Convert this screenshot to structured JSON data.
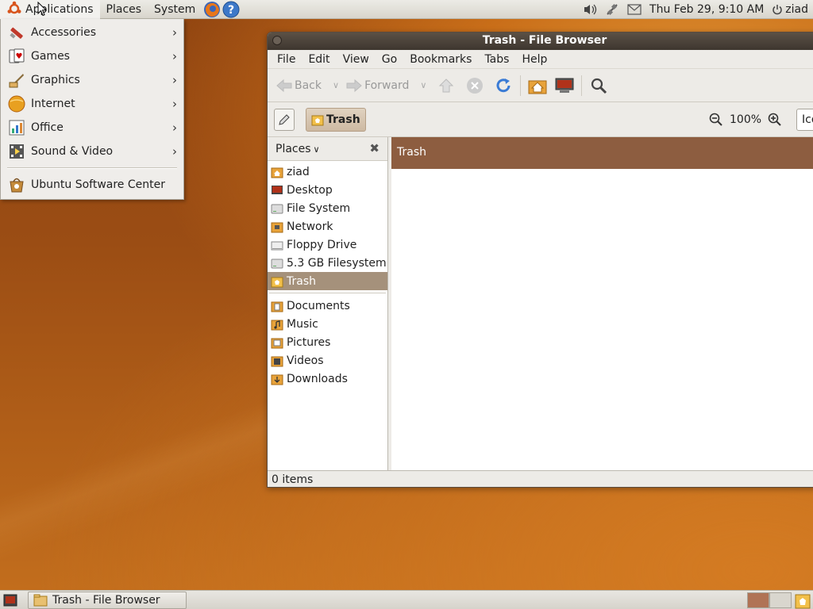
{
  "top_panel": {
    "menus": [
      "Applications",
      "Places",
      "System"
    ],
    "clock": "Thu Feb 29,  9:10 AM",
    "user": "ziad",
    "icons": [
      "ubuntu-logo-icon",
      "firefox-icon",
      "help-icon",
      "volume-icon",
      "network-icon",
      "mail-icon",
      "power-icon"
    ]
  },
  "apps_menu": {
    "items": [
      {
        "label": "Accessories",
        "icon": "accessories-icon",
        "submenu": true
      },
      {
        "label": "Games",
        "icon": "games-icon",
        "submenu": true
      },
      {
        "label": "Graphics",
        "icon": "graphics-icon",
        "submenu": true
      },
      {
        "label": "Internet",
        "icon": "internet-icon",
        "submenu": true
      },
      {
        "label": "Office",
        "icon": "office-icon",
        "submenu": true
      },
      {
        "label": "Sound & Video",
        "icon": "sound-video-icon",
        "submenu": true
      },
      {
        "label": "Ubuntu Software Center",
        "icon": "software-center-icon",
        "submenu": false
      }
    ]
  },
  "window": {
    "title": "Trash - File Browser",
    "menubar": [
      "File",
      "Edit",
      "View",
      "Go",
      "Bookmarks",
      "Tabs",
      "Help"
    ],
    "toolbar": {
      "back": "Back",
      "forward": "Forward"
    },
    "location": {
      "crumb": "Trash",
      "zoom": "100%",
      "view_mode": "Icons"
    },
    "sidebar": {
      "title": "Places",
      "places": [
        "ziad",
        "Desktop",
        "File System",
        "Network",
        "Floppy Drive",
        "5.3 GB Filesystem",
        "Trash"
      ],
      "bookmarks": [
        "Documents",
        "Music",
        "Pictures",
        "Videos",
        "Downloads"
      ],
      "selected": "Trash"
    },
    "content_header": "Trash",
    "status": "0 items"
  },
  "bottom_panel": {
    "task": "Trash - File Browser"
  },
  "colors": {
    "accent": "#a5917b",
    "header": "#8d5d40",
    "titlebar": "#3e362f"
  }
}
